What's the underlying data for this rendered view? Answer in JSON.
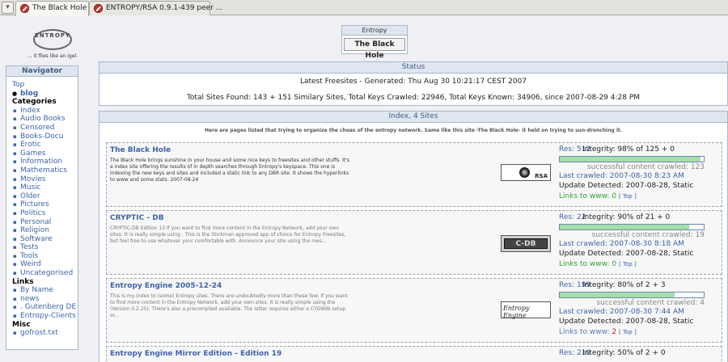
{
  "tabs": [
    {
      "label": "The Black Hole",
      "active": true
    },
    {
      "label": "ENTROPY/RSA 0.9.1-439 peer ...",
      "active": false
    }
  ],
  "logo": {
    "text": "ENTROPY",
    "slogan": "... it flies like an igel."
  },
  "brand": {
    "header": "Entropy",
    "name": "The Black Hole"
  },
  "navigator": {
    "title": "Navigator",
    "top": "Top",
    "blog": "blog",
    "categories_title": "Categories",
    "categories": [
      "Index",
      "Audio Books",
      "Censored",
      "Books-Docu",
      "Erotic",
      "Games",
      "Information",
      "Mathematics",
      "Movies",
      "Music",
      "Older",
      "Pictures",
      "Politics",
      "Personal",
      "Religion",
      "Software",
      "Tests",
      "Tools",
      "Weird",
      "Uncategorised"
    ],
    "links_title": "Links",
    "links": [
      "By Name",
      "news",
      ". Gutenberg DE",
      "Entropy-Clients"
    ],
    "misc_title": "Misc",
    "misc": [
      "gofrost.txt"
    ]
  },
  "status": {
    "title": "Status",
    "line1": "Latest Freesites - Generated: Thu Aug 30 10:21:17 CEST 2007",
    "line2": "Total Sites Found: 143 + 151 Similary Sites, Total Keys Crawled: 22946, Total Keys Known: 34906, since 2007-08-29 4:28 PM"
  },
  "index": {
    "title": "Index, 4 Sites",
    "intro": "Here are pages listed that trying to organize the choas of the entropy network. Same like this site -The Black Hole- it held on trying to sun-drenching it.",
    "entries": [
      {
        "title": "The Black Hole",
        "desc": "The Black Hole brings sunshine in your house and some nice keys to freesites and other stuffs. It's a index site offering the results of in depth searches through Entropy's keyspace. This one is indexing the new keys and sites and included a static link to any DBR site. It shows the hyperlinks to www and some stats. 2007-08-24",
        "badge": "RSA",
        "res": "Res: 512",
        "integrity": "Integrity: 98% of 125 + 0",
        "integrity_fraction": 0.98,
        "success": "successful content crawled: 123",
        "last_crawled": "Last crawled: 2007-08-30 8:23 AM",
        "update": "Update Detected: 2007-08-28, Static",
        "links_label": "Links to www: ",
        "links_count": "0",
        "links_color": "#2fa52f",
        "top_link": "[ Top ]"
      },
      {
        "title": "CRYPTIC - DB",
        "desc": "CRYPTIC-DB Edition 13 If you want to find more content in the Entropy Network, add your own sites. It is really simple using . This is the Stickman approved app of choice for Entropy Freesites, but feel free to use whatever your comfortable with. Announce your site using the mes...",
        "badge": "C-DB",
        "res": "Res: 22",
        "integrity": "Integrity: 90% of 21 + 0",
        "integrity_fraction": 0.9,
        "success": "successful content crawled: 19",
        "last_crawled": "Last crawled: 2007-08-30 8:18 AM",
        "update": "Update Detected: 2007-08-28, Static",
        "links_label": "Links to www: ",
        "links_count": "0",
        "links_color": "#2fa52f",
        "top_link": "[ Top ]"
      },
      {
        "title": "Entropy Engine 2005-12-24",
        "desc": "This is my index to (some) Entropy sites. There are undoubtedly more than these few. If you want to find more content in the Entropy Network, add your own sites. It is really simple using the (Version 0.2.25). There's also a precompiled available. The latter requires either a CYGWIN setup or...",
        "badge": "Entropy Engine",
        "res": "Res: 199",
        "integrity": "Integrity: 80% of 2 + 3",
        "integrity_fraction": 0.8,
        "success": "successful content crawled: 4",
        "last_crawled": "Last crawled: 2007-08-30 7:44 AM",
        "update": "Update Detected: 2007-08-28, Static",
        "links_label": "Links to www: ",
        "links_count": "2",
        "links_color": "#c02020",
        "top_link": "[ Top ]"
      },
      {
        "title": "Entropy Engine Mirror Edition - Edition 19",
        "res": "Res: 210",
        "integrity": "Integrity: 50% of 2 + 0"
      }
    ]
  }
}
